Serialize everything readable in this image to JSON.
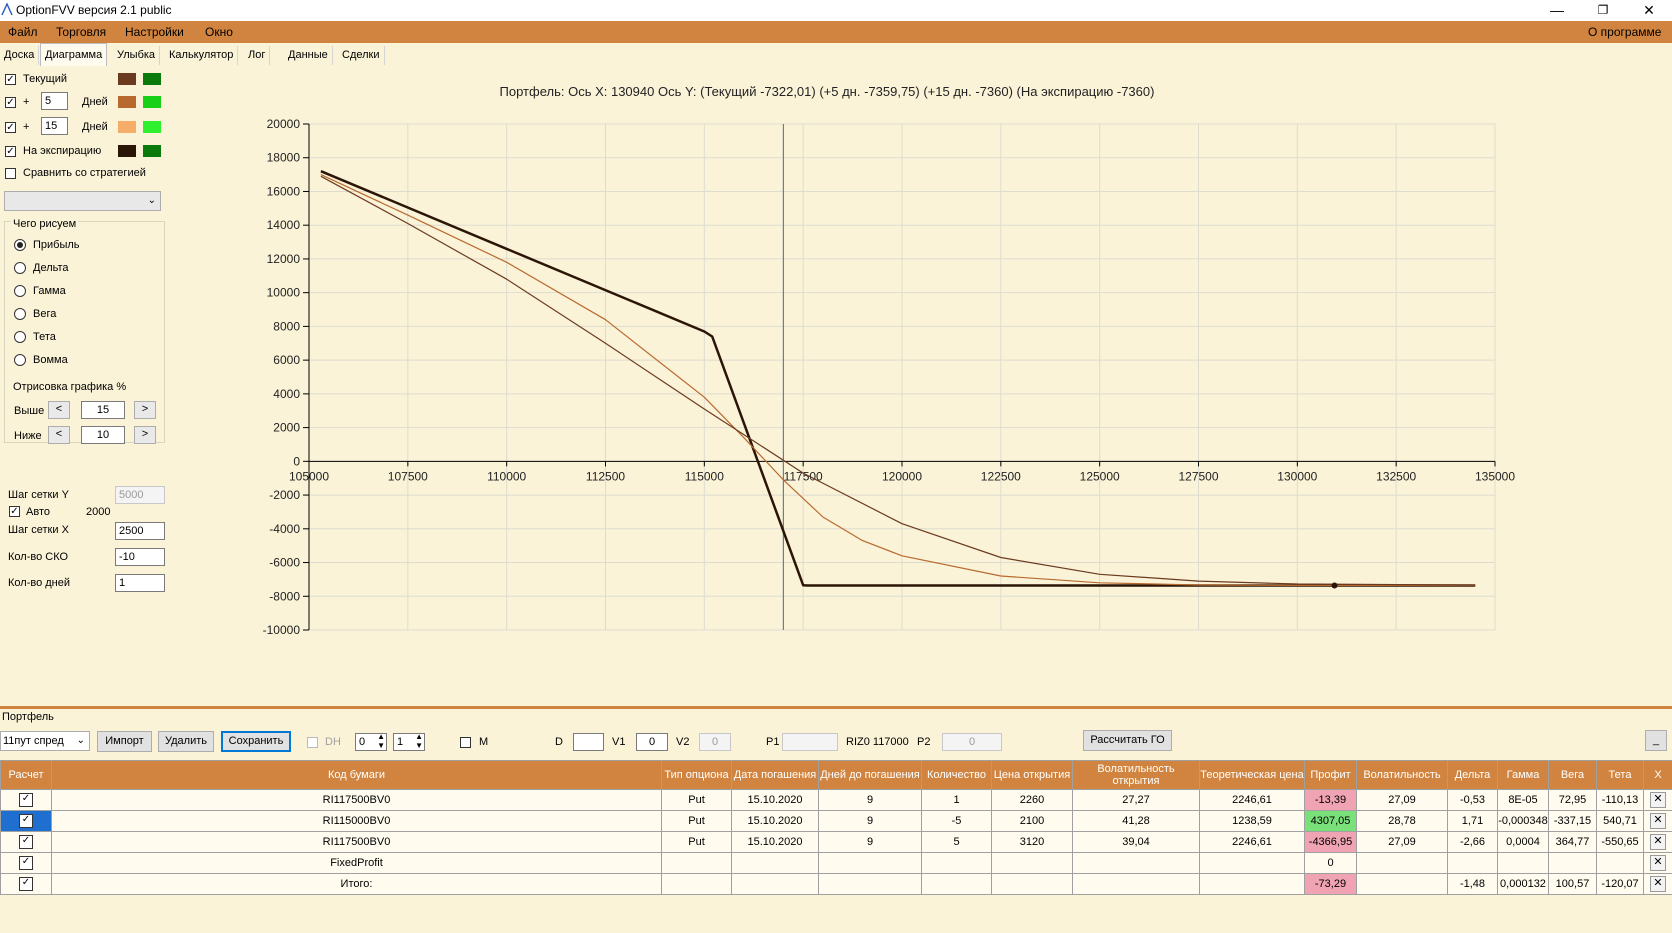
{
  "window": {
    "title": "OptionFVV версия 2.1 public",
    "min_icon": "minimize-icon",
    "max_icon": "restore-icon",
    "close_icon": "close-icon"
  },
  "menu": {
    "items": [
      "Файл",
      "Торговля",
      "Настройки",
      "Окно"
    ],
    "about": "О программе"
  },
  "tabs": [
    "Доска",
    "Диаграмма",
    "Улыбка",
    "Калькулятор",
    "Лог",
    "Данные",
    "Сделки"
  ],
  "active_tab": "Диаграмма",
  "left": {
    "current_label": "Текущий",
    "plus": "+",
    "days_label": "Дней",
    "days1": "5",
    "days2": "15",
    "expiration_label": "На экспирацию",
    "compare_label": "Сравнить со стратегией",
    "swatches": {
      "current": [
        "#6b3a1f",
        "#0b7a0b"
      ],
      "d5": [
        "#b86a2e",
        "#18d018"
      ],
      "d15": [
        "#f7ad6a",
        "#2ef02e"
      ],
      "exp": [
        "#2a1506",
        "#0b7a0b"
      ]
    },
    "draw_group": "Чего рисуем",
    "draw_options": [
      "Прибыль",
      "Дельта",
      "Гамма",
      "Вега",
      "Тета",
      "Вомма"
    ],
    "selected_option": "Прибыль",
    "render_group": "Отрисовка графика %",
    "above_label": "Выше",
    "above_value": "15",
    "below_label": "Ниже",
    "below_value": "10",
    "prev": "<",
    "next": ">",
    "grid_y_label": "Шаг сетки Y",
    "grid_y_value": "5000",
    "auto_label": "Авто",
    "auto_value": "2000",
    "grid_x_label": "Шаг сетки X",
    "grid_x_value": "2500",
    "sko_label": "Кол-во СКО",
    "sko_value": "-10",
    "days_count_label": "Кол-во дней",
    "days_count_value": "1"
  },
  "chart_data": {
    "type": "line",
    "title": "Портфель: Ось X: 130940 Ось Y:  (Текущий -7322,01)  (+5 дн. -7359,75)  (+15 дн. -7360)  (На экспирацию -7360)",
    "xlim": [
      105000,
      135000
    ],
    "ylim": [
      -10000,
      20000
    ],
    "x_ticks": [
      105000,
      107500,
      110000,
      112500,
      115000,
      117500,
      120000,
      122500,
      125000,
      127500,
      130000,
      132500,
      135000
    ],
    "y_ticks": [
      20000,
      18000,
      16000,
      14000,
      12000,
      10000,
      8000,
      6000,
      4000,
      2000,
      0,
      -2000,
      -4000,
      -6000,
      -8000,
      -10000
    ],
    "grid": true,
    "vline_x": 117000,
    "marker": {
      "x": 130940,
      "y": -7360
    },
    "series": [
      {
        "color": "#2a1506",
        "x": [
          105300,
          115000,
          115200,
          117500,
          117600,
          134500
        ],
        "y": [
          17200,
          7700,
          7400,
          -7350,
          -7360,
          -7360
        ]
      },
      {
        "color": "#b86a2e",
        "x": [
          105300,
          107500,
          110000,
          112500,
          115000,
          116000,
          117000,
          118000,
          119000,
          120000,
          122500,
          125000,
          127500,
          130000,
          134500
        ],
        "y": [
          17000,
          14600,
          11800,
          8400,
          3800,
          1400,
          -1100,
          -3300,
          -4700,
          -5600,
          -6800,
          -7200,
          -7330,
          -7355,
          -7360
        ]
      },
      {
        "color": "#6b3a1f",
        "x": [
          105300,
          107500,
          110000,
          112500,
          115000,
          117500,
          120000,
          122500,
          125000,
          127500,
          130000,
          134500
        ],
        "y": [
          16900,
          14100,
          10800,
          7000,
          3100,
          -700,
          -3700,
          -5700,
          -6700,
          -7100,
          -7270,
          -7340
        ]
      }
    ]
  },
  "portfolio": {
    "title": "Портфель",
    "strategy": "11пут спред",
    "import": "Импорт",
    "delete": "Удалить",
    "save": "Сохранить",
    "dh_label": "DH",
    "spin1": "0",
    "spin2": "1",
    "m_label": "M",
    "d_label": "D",
    "v1_label": "V1",
    "v1_value": "0",
    "v2_label": "V2",
    "v2_value": "0",
    "p1_label": "P1",
    "riz_label": "RIZ0 117000",
    "p2_label": "P2",
    "p2_value": "0",
    "calc_go": "Рассчитать ГО",
    "minimize": "_",
    "columns": [
      "Расчет",
      "Код бумаги",
      "Тип опциона",
      "Дата погашения",
      "Дней до погашения",
      "Количество",
      "Цена открытия",
      "Волатильность открытия",
      "Теоретическая цена",
      "Профит",
      "Волатильность",
      "Дельта",
      "Гамма",
      "Вега",
      "Тета",
      "X"
    ],
    "rows": [
      {
        "code": "RI117500BV0",
        "type": "Put",
        "date": "15.10.2020",
        "days": "9",
        "qty": "1",
        "price": "2260",
        "vol_open": "27,27",
        "theo": "2246,61",
        "profit": "-13,39",
        "profit_color": "red",
        "vol": "27,09",
        "delta": "-0,53",
        "gamma": "8E-05",
        "vega": "72,95",
        "theta": "-110,13",
        "selected": false
      },
      {
        "code": "RI115000BV0",
        "type": "Put",
        "date": "15.10.2020",
        "days": "9",
        "qty": "-5",
        "price": "2100",
        "vol_open": "41,28",
        "theo": "1238,59",
        "profit": "4307,05",
        "profit_color": "green",
        "vol": "28,78",
        "delta": "1,71",
        "gamma": "-0,000348",
        "vega": "-337,15",
        "theta": "540,71",
        "selected": true
      },
      {
        "code": "RI117500BV0",
        "type": "Put",
        "date": "15.10.2020",
        "days": "9",
        "qty": "5",
        "price": "3120",
        "vol_open": "39,04",
        "theo": "2246,61",
        "profit": "-4366,95",
        "profit_color": "red",
        "vol": "27,09",
        "delta": "-2,66",
        "gamma": "0,0004",
        "vega": "364,77",
        "theta": "-550,65",
        "selected": false
      },
      {
        "code": "FixedProfit",
        "type": "",
        "date": "",
        "days": "",
        "qty": "",
        "price": "",
        "vol_open": "",
        "theo": "",
        "profit": "0",
        "profit_color": "none",
        "vol": "",
        "delta": "",
        "gamma": "",
        "vega": "",
        "theta": "",
        "selected": false
      },
      {
        "code": "Итого:",
        "type": "",
        "date": "",
        "days": "",
        "qty": "",
        "price": "",
        "vol_open": "",
        "theo": "",
        "profit": "-73,29",
        "profit_color": "red",
        "vol": "",
        "delta": "-1,48",
        "gamma": "0,000132",
        "vega": "100,57",
        "theta": "-120,07",
        "selected": false
      }
    ]
  }
}
